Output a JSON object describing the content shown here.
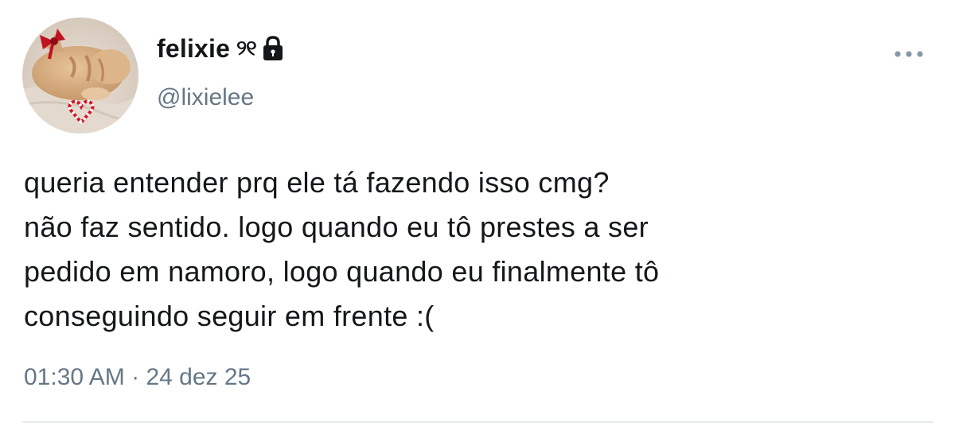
{
  "tweet": {
    "display_name": "felixie",
    "name_emoji": "୨୧",
    "handle": "@lixielee",
    "text": "queria entender prq ele tá fazendo isso cmg?\nnão faz sentido. logo quando eu tô prestes a ser\npedido em namoro, logo quando eu finalmente tô\nconseguindo seguir em frente :(",
    "time": "01:30 AM",
    "separator": "·",
    "date": "24 dez 25"
  },
  "icons": {
    "lock": "lock-icon",
    "more": "more-options-icon",
    "avatar": "avatar-cat-photo"
  },
  "colors": {
    "text_primary": "#14171a",
    "text_secondary": "#657786",
    "divider": "#e6ecf0"
  }
}
